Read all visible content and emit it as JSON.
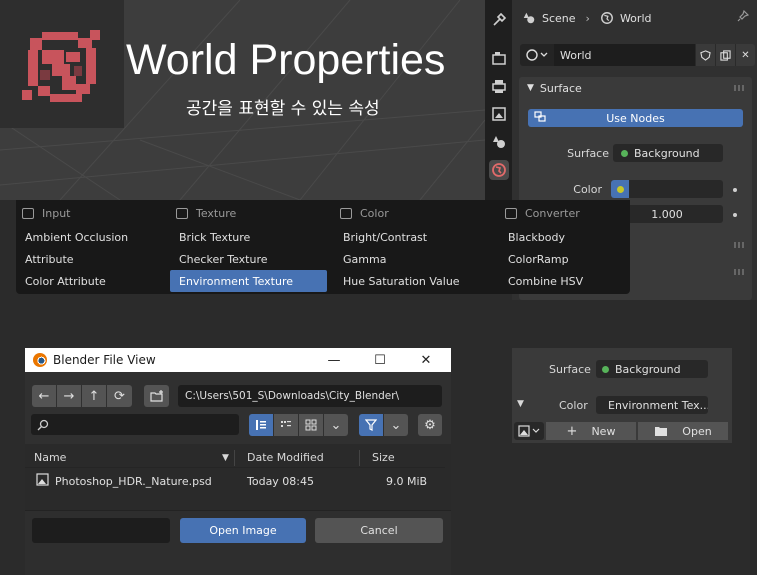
{
  "viewport": {
    "title": "World Properties",
    "subtitle": "공간을 표현할 수 있는 속성"
  },
  "properties": {
    "breadcrumb": [
      "Scene",
      "World"
    ],
    "world_name": "World",
    "panel_title": "Surface",
    "use_nodes_label": "Use Nodes",
    "surface_label": "Surface",
    "surface_value": "Background",
    "color_label": "Color",
    "strength_value": "1.000"
  },
  "add_menu": {
    "columns": [
      {
        "title": "Input",
        "items": [
          "Ambient Occlusion",
          "Attribute",
          "Color Attribute"
        ]
      },
      {
        "title": "Texture",
        "items": [
          "Brick Texture",
          "Checker Texture",
          "Environment Texture"
        ]
      },
      {
        "title": "Color",
        "items": [
          "Bright/Contrast",
          "Gamma",
          "Hue Saturation Value"
        ]
      },
      {
        "title": "Converter",
        "items": [
          "Blackbody",
          "ColorRamp",
          "Combine HSV"
        ]
      }
    ],
    "highlighted": "Environment Texture"
  },
  "file_view": {
    "title": "Blender File View",
    "path": "C:\\Users\\501_S\\Downloads\\City_Blender\\",
    "search_value": "",
    "columns": {
      "name": "Name",
      "date": "Date Modified",
      "size": "Size"
    },
    "rows": [
      {
        "name": "Photoshop_HDR._Nature.psd",
        "date": "Today 08:45",
        "size": "9.0 MiB"
      }
    ],
    "filename_value": "",
    "open_label": "Open Image",
    "cancel_label": "Cancel"
  },
  "node_panel": {
    "surface_label": "Surface",
    "surface_value": "Background",
    "color_label": "Color",
    "color_value": "Environment Tex...",
    "new_label": "New",
    "open_label": "Open"
  },
  "colors": {
    "accent": "#4772b3",
    "background": "#2b2b2b",
    "panel": "#3a3a3a",
    "shader_socket": "#57b35a",
    "color_socket": "#c7c729",
    "world_icon": "#e06a6a"
  }
}
